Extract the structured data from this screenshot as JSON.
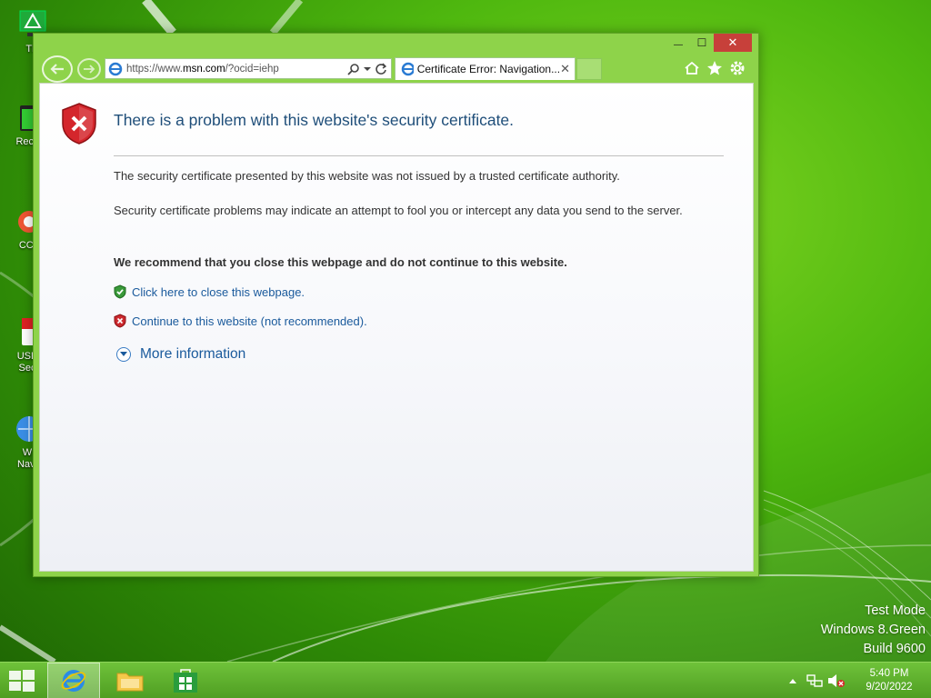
{
  "desktop": {
    "icons": [
      {
        "label": "Thi"
      },
      {
        "label": "Recy"
      },
      {
        "label": "CCl"
      },
      {
        "label": "USB\nSec"
      },
      {
        "label": "W\nNavi"
      }
    ],
    "watermark": {
      "line1": "Test Mode",
      "line2": "Windows 8.Green",
      "line3": "Build 9600"
    }
  },
  "window": {
    "address": {
      "prefix": "https://www.",
      "domain": "msn.com",
      "path": "/?ocid=iehp"
    },
    "tab": {
      "title": "Certificate Error: Navigation...",
      "close": "✕"
    },
    "caption": {
      "minimize": "—",
      "maximize": "☐",
      "close": "✕"
    }
  },
  "page": {
    "title": "There is a problem with this website's security certificate.",
    "paragraph1": "The security certificate presented by this website was not issued by a trusted certificate authority.",
    "paragraph2": "Security certificate problems may indicate an attempt to fool you or intercept any data you send to the server.",
    "recommendation": "We recommend that you close this webpage and do not continue to this website.",
    "close_link": "Click here to close this webpage.",
    "continue_link": "Continue to this website (not recommended).",
    "more_info": "More information"
  },
  "taskbar": {
    "clock": {
      "time": "5:40 PM",
      "date": "9/20/2022"
    },
    "pinned": [
      "Internet Explorer",
      "File Explorer",
      "Store"
    ]
  },
  "colors": {
    "accent_green": "#7ed321",
    "link_blue": "#1a5a9c",
    "title_blue": "#1f4e79",
    "close_red": "#c7403a"
  }
}
